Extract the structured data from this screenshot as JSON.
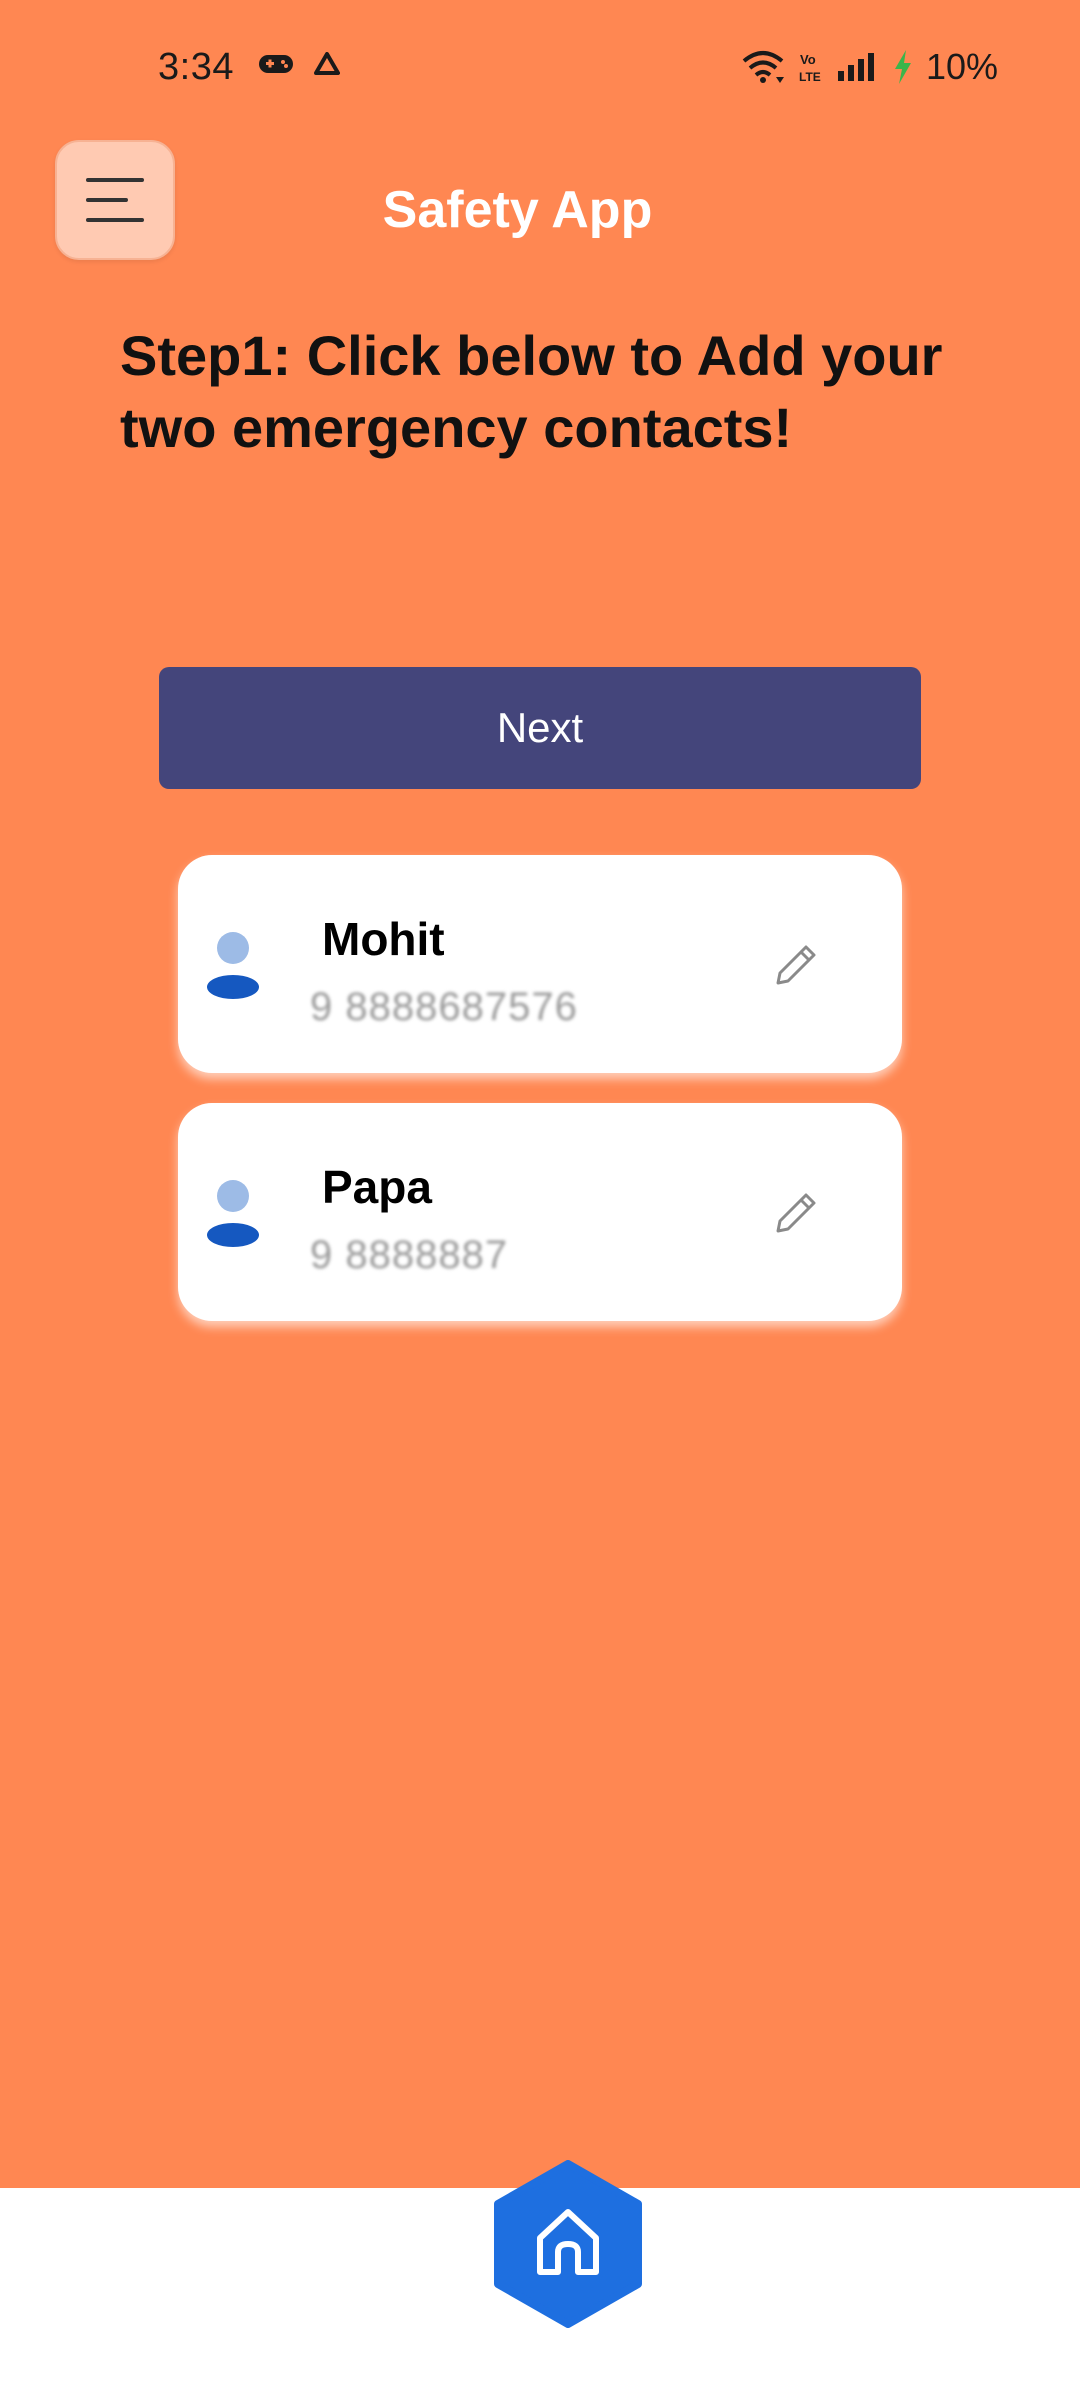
{
  "status_bar": {
    "time": "3:34",
    "battery": "10%",
    "left_icons": [
      "gamepad-icon",
      "drive-icon"
    ],
    "right_icons": [
      "wifi-icon",
      "volte-icon",
      "signal-icon",
      "charging-icon"
    ]
  },
  "header": {
    "title": "Safety App",
    "menu_icon": "hamburger-menu-icon"
  },
  "main": {
    "step_heading": "Step1: Click below to Add your two emergency contacts!",
    "next_label": "Next"
  },
  "contacts": [
    {
      "name": "Mohit",
      "phone": "9  8888687576",
      "icon": "person-icon",
      "action_icon": "pencil-icon"
    },
    {
      "name": "Papa",
      "phone": "9  8888887",
      "icon": "person-icon",
      "action_icon": "pencil-icon"
    }
  ],
  "bottom_nav": {
    "home_icon": "home-icon"
  },
  "colors": {
    "background": "#FF8752",
    "menu_button": "#FFCAB2",
    "next_button": "#44457B",
    "home_button": "#1E6FE0",
    "avatar_light": "#9DBBE6",
    "avatar_dark": "#1558C0"
  }
}
